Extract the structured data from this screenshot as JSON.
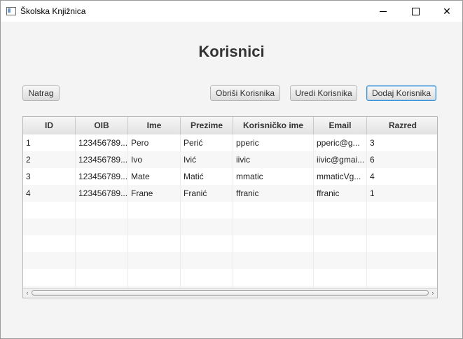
{
  "window": {
    "title": "Školska Knjižnica"
  },
  "page": {
    "title": "Korisnici"
  },
  "toolbar": {
    "back_label": "Natrag",
    "delete_label": "Obriši Korisnika",
    "edit_label": "Uredi Korisnika",
    "add_label": "Dodaj Korisnika"
  },
  "table": {
    "columns": [
      "ID",
      "OIB",
      "Ime",
      "Prezime",
      "Korisničko ime",
      "Email",
      "Razred"
    ],
    "rows": [
      [
        "1",
        "123456789...",
        "Pero",
        "Perić",
        "pperic",
        "pperic@g...",
        "3"
      ],
      [
        "2",
        "123456789...",
        "Ivo",
        "Ivić",
        "iivic",
        "iivic@gmai...",
        "6"
      ],
      [
        "3",
        "123456789...",
        "Mate",
        "Matić",
        "mmatic",
        "mmaticVg...",
        "4"
      ],
      [
        "4",
        "123456789...",
        "Frane",
        "Franić",
        "ffranic",
        "ffranic",
        "1"
      ]
    ]
  },
  "icons": {
    "window_minimize": "minimize-icon",
    "window_maximize": "maximize-icon",
    "window_close": "close-icon",
    "scroll_left": "chevron-left-icon",
    "scroll_right": "chevron-right-icon"
  },
  "colors": {
    "focus_border": "#3b8fd3",
    "background": "#f4f4f4"
  }
}
